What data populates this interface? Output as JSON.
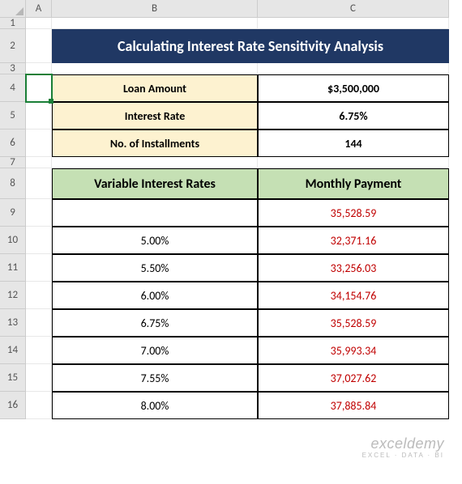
{
  "columns": [
    "A",
    "B",
    "C"
  ],
  "rows": [
    "1",
    "2",
    "3",
    "4",
    "5",
    "6",
    "7",
    "8",
    "9",
    "10",
    "11",
    "12",
    "13",
    "14",
    "15",
    "16"
  ],
  "title": "Calculating Interest Rate Sensitivity Analysis",
  "inputs": {
    "loanAmount": {
      "label": "Loan Amount",
      "value": "$3,500,000"
    },
    "interestRate": {
      "label": "Interest Rate",
      "value": "6.75%"
    },
    "installments": {
      "label": "No. of Installments",
      "value": "144"
    }
  },
  "tableHeaders": {
    "rates": "Variable Interest Rates",
    "payment": "Monthly Payment"
  },
  "tableRows": [
    {
      "rate": "",
      "payment": "35,528.59"
    },
    {
      "rate": "5.00%",
      "payment": "32,371.16"
    },
    {
      "rate": "5.50%",
      "payment": "33,256.03"
    },
    {
      "rate": "6.00%",
      "payment": "34,154.76"
    },
    {
      "rate": "6.75%",
      "payment": "35,528.59"
    },
    {
      "rate": "7.00%",
      "payment": "35,993.34"
    },
    {
      "rate": "7.55%",
      "payment": "37,027.62"
    },
    {
      "rate": "8.00%",
      "payment": "37,885.84"
    }
  ],
  "watermark": {
    "line1": "exceldemy",
    "line2": "EXCEL · DATA · BI"
  },
  "chart_data": {
    "type": "table",
    "title": "Calculating Interest Rate Sensitivity Analysis",
    "inputs": {
      "loan_amount_usd": 3500000,
      "interest_rate_pct": 6.75,
      "num_installments": 144
    },
    "columns": [
      "Variable Interest Rate (%)",
      "Monthly Payment"
    ],
    "rows": [
      [
        null,
        35528.59
      ],
      [
        5.0,
        32371.16
      ],
      [
        5.5,
        33256.03
      ],
      [
        6.0,
        34154.76
      ],
      [
        6.75,
        35528.59
      ],
      [
        7.0,
        35993.34
      ],
      [
        7.55,
        37027.62
      ],
      [
        8.0,
        37885.84
      ]
    ]
  }
}
